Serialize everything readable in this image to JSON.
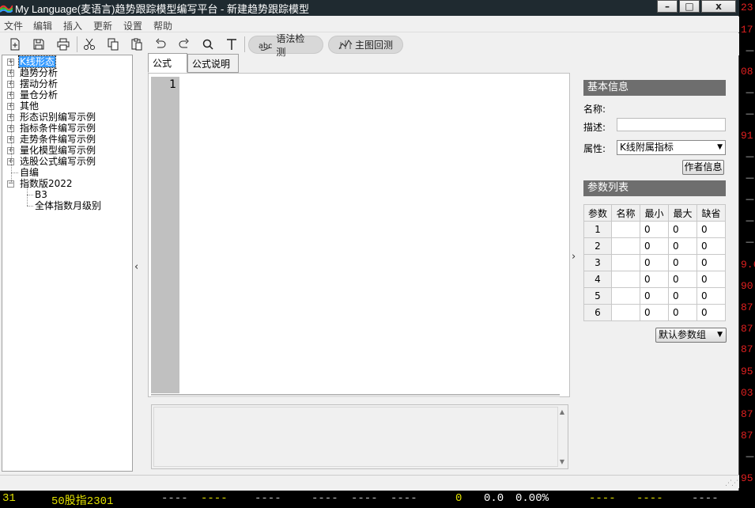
{
  "window": {
    "title": "My Language(麦语言)趋势跟踪模型编写平台 - 新建趋势跟踪模型",
    "controls": {
      "minimize": "–",
      "maximize": "□",
      "close": "x"
    }
  },
  "menu": [
    "文件",
    "编辑",
    "插入",
    "更新",
    "设置",
    "帮助"
  ],
  "toolbar": {
    "icons": [
      "new-file-icon",
      "save-icon",
      "print-icon",
      "cut-icon",
      "copy-icon",
      "paste-icon",
      "undo-icon",
      "redo-icon",
      "search-icon",
      "text-icon"
    ],
    "syntax_check": "语法检测",
    "main_backtest": "主图回测"
  },
  "tree": {
    "items": [
      {
        "label": "K线形态",
        "expandable": true,
        "selected": true
      },
      {
        "label": "趋势分析",
        "expandable": true
      },
      {
        "label": "摆动分析",
        "expandable": true
      },
      {
        "label": "量仓分析",
        "expandable": true
      },
      {
        "label": "其他",
        "expandable": true
      },
      {
        "label": "形态识别编写示例",
        "expandable": true
      },
      {
        "label": "指标条件编写示例",
        "expandable": true
      },
      {
        "label": "走势条件编写示例",
        "expandable": true
      },
      {
        "label": "量化模型编写示例",
        "expandable": true
      },
      {
        "label": "选股公式编写示例",
        "expandable": true
      },
      {
        "label": "自编",
        "expandable": false
      },
      {
        "label": "指数版2022",
        "expandable": true,
        "expanded": true
      }
    ],
    "children": [
      "B3",
      "全体指数月级别"
    ]
  },
  "tabs": [
    "公式",
    "公式说明"
  ],
  "editor": {
    "line_number": "1"
  },
  "basic_info": {
    "header": "基本信息",
    "name_label": "名称:",
    "desc_label": "描述:",
    "attr_label": "属性:",
    "attr_value": "K线附属指标",
    "author_button": "作者信息"
  },
  "params": {
    "header": "参数列表",
    "columns": [
      "参数",
      "名称",
      "最小",
      "最大",
      "缺省"
    ],
    "rows": [
      {
        "n": "1",
        "min": "0",
        "max": "0",
        "def": "0"
      },
      {
        "n": "2",
        "min": "0",
        "max": "0",
        "def": "0"
      },
      {
        "n": "3",
        "min": "0",
        "max": "0",
        "def": "0"
      },
      {
        "n": "4",
        "min": "0",
        "max": "0",
        "def": "0"
      },
      {
        "n": "5",
        "min": "0",
        "max": "0",
        "def": "0"
      },
      {
        "n": "6",
        "min": "0",
        "max": "0",
        "def": "0"
      }
    ],
    "default_group": "默认参数组"
  },
  "background": {
    "right_numbers": [
      "23.",
      "17.",
      "08.",
      "91.",
      "9.6",
      "90.",
      "87.",
      "87.",
      "87.",
      "95.",
      "03.",
      "87.",
      "87.",
      "95."
    ],
    "bottom": {
      "code": "31",
      "name": "50股指2301",
      "dash": "----",
      "zero": "0",
      "change": "0.0",
      "pct": "0.00%"
    }
  },
  "colors": {
    "accent": "#3399ff",
    "header_gray": "#6e6e6e",
    "bg_red": "#e02020",
    "bg_yellow": "#e0e000"
  }
}
